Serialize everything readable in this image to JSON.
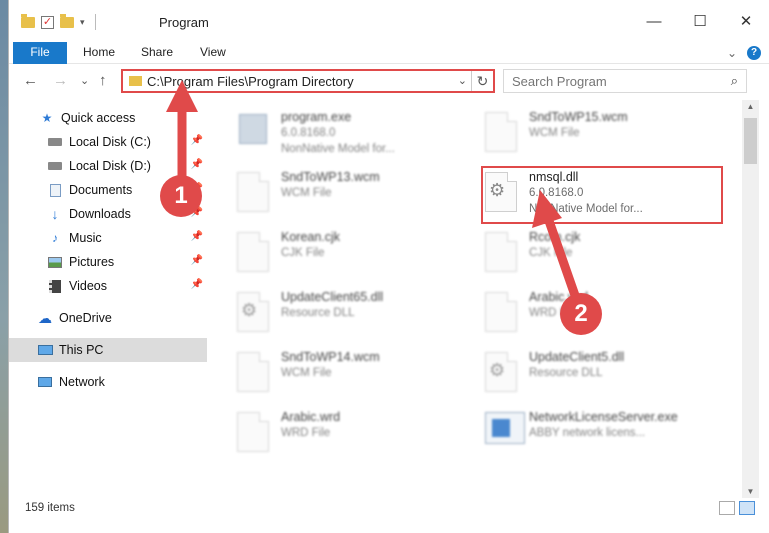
{
  "window": {
    "title": "Program",
    "minimize": "—",
    "maximize": "☐",
    "close": "✕"
  },
  "ribbon": {
    "tabs": [
      "File",
      "Home",
      "Share",
      "View"
    ],
    "expand": "⌄",
    "help": "?"
  },
  "nav": {
    "back": "←",
    "forward": "→",
    "recent": "⌄",
    "up": "↑",
    "address": "C:\\Program Files\\Program Directory",
    "address_dropdown": "⌄",
    "refresh": "↻",
    "search_placeholder": "Search Program",
    "search_icon": "⌕"
  },
  "sidebar": {
    "items": [
      {
        "label": "Quick access",
        "icon": "star-icon",
        "pinned": false
      },
      {
        "label": "Local Disk (C:)",
        "icon": "drive-icon",
        "pinned": true
      },
      {
        "label": "Local Disk (D:)",
        "icon": "drive-icon",
        "pinned": true
      },
      {
        "label": "Documents",
        "icon": "documents-icon",
        "pinned": true
      },
      {
        "label": "Downloads",
        "icon": "download-icon",
        "pinned": true
      },
      {
        "label": "Music",
        "icon": "music-icon",
        "pinned": true
      },
      {
        "label": "Pictures",
        "icon": "pictures-icon",
        "pinned": true
      },
      {
        "label": "Videos",
        "icon": "videos-icon",
        "pinned": true
      },
      {
        "label": "OneDrive",
        "icon": "cloud-icon",
        "pinned": false
      },
      {
        "label": "This PC",
        "icon": "computer-icon",
        "pinned": false,
        "selected": true
      },
      {
        "label": "Network",
        "icon": "network-icon",
        "pinned": false
      }
    ]
  },
  "files": [
    {
      "name": "program.exe",
      "line1": "6.0.8168.0",
      "line2": "NonNative Model for...",
      "icon": "exe-icon",
      "blurred": true
    },
    {
      "name": "SndToWP15.wcm",
      "line1": "WCM File",
      "line2": "",
      "icon": "file-icon",
      "blurred": true
    },
    {
      "name": "SndToWP13.wcm",
      "line1": "WCM File",
      "line2": "",
      "icon": "file-icon",
      "blurred": true
    },
    {
      "name": "nmsql.dll",
      "line1": "6.0.8168.0",
      "line2": "NonNative Model for...",
      "icon": "dll-icon",
      "blurred": false,
      "highlighted": true
    },
    {
      "name": "Korean.cjk",
      "line1": "CJK File",
      "line2": "",
      "icon": "file-icon",
      "blurred": true
    },
    {
      "name": "Rcom.cjk",
      "line1": "CJK File",
      "line2": "",
      "icon": "file-icon",
      "blurred": true
    },
    {
      "name": "UpdateClient65.dll",
      "line1": "Resource DLL",
      "line2": "",
      "icon": "dll-icon",
      "blurred": true
    },
    {
      "name": "Arabic.wrd",
      "line1": "WRD File",
      "line2": "",
      "icon": "file-icon",
      "blurred": true
    },
    {
      "name": "SndToWP14.wcm",
      "line1": "WCM File",
      "line2": "",
      "icon": "file-icon",
      "blurred": true
    },
    {
      "name": "UpdateClient5.dll",
      "line1": "Resource DLL",
      "line2": "",
      "icon": "dll-icon",
      "blurred": true
    },
    {
      "name": "Arabic.wrd",
      "line1": "WRD File",
      "line2": "",
      "icon": "file-icon",
      "blurred": true
    },
    {
      "name": "NetworkLicenseServer.exe",
      "line1": "ABBY network licens...",
      "line2": "",
      "icon": "exe-icon",
      "blurred": true
    }
  ],
  "status": {
    "items_count": "159 items"
  },
  "annotations": {
    "step1": "1",
    "step2": "2",
    "color": "#e04a4a"
  },
  "colors": {
    "accent": "#1979ca",
    "highlight": "#e04a4a",
    "folder": "#e8c04a"
  }
}
